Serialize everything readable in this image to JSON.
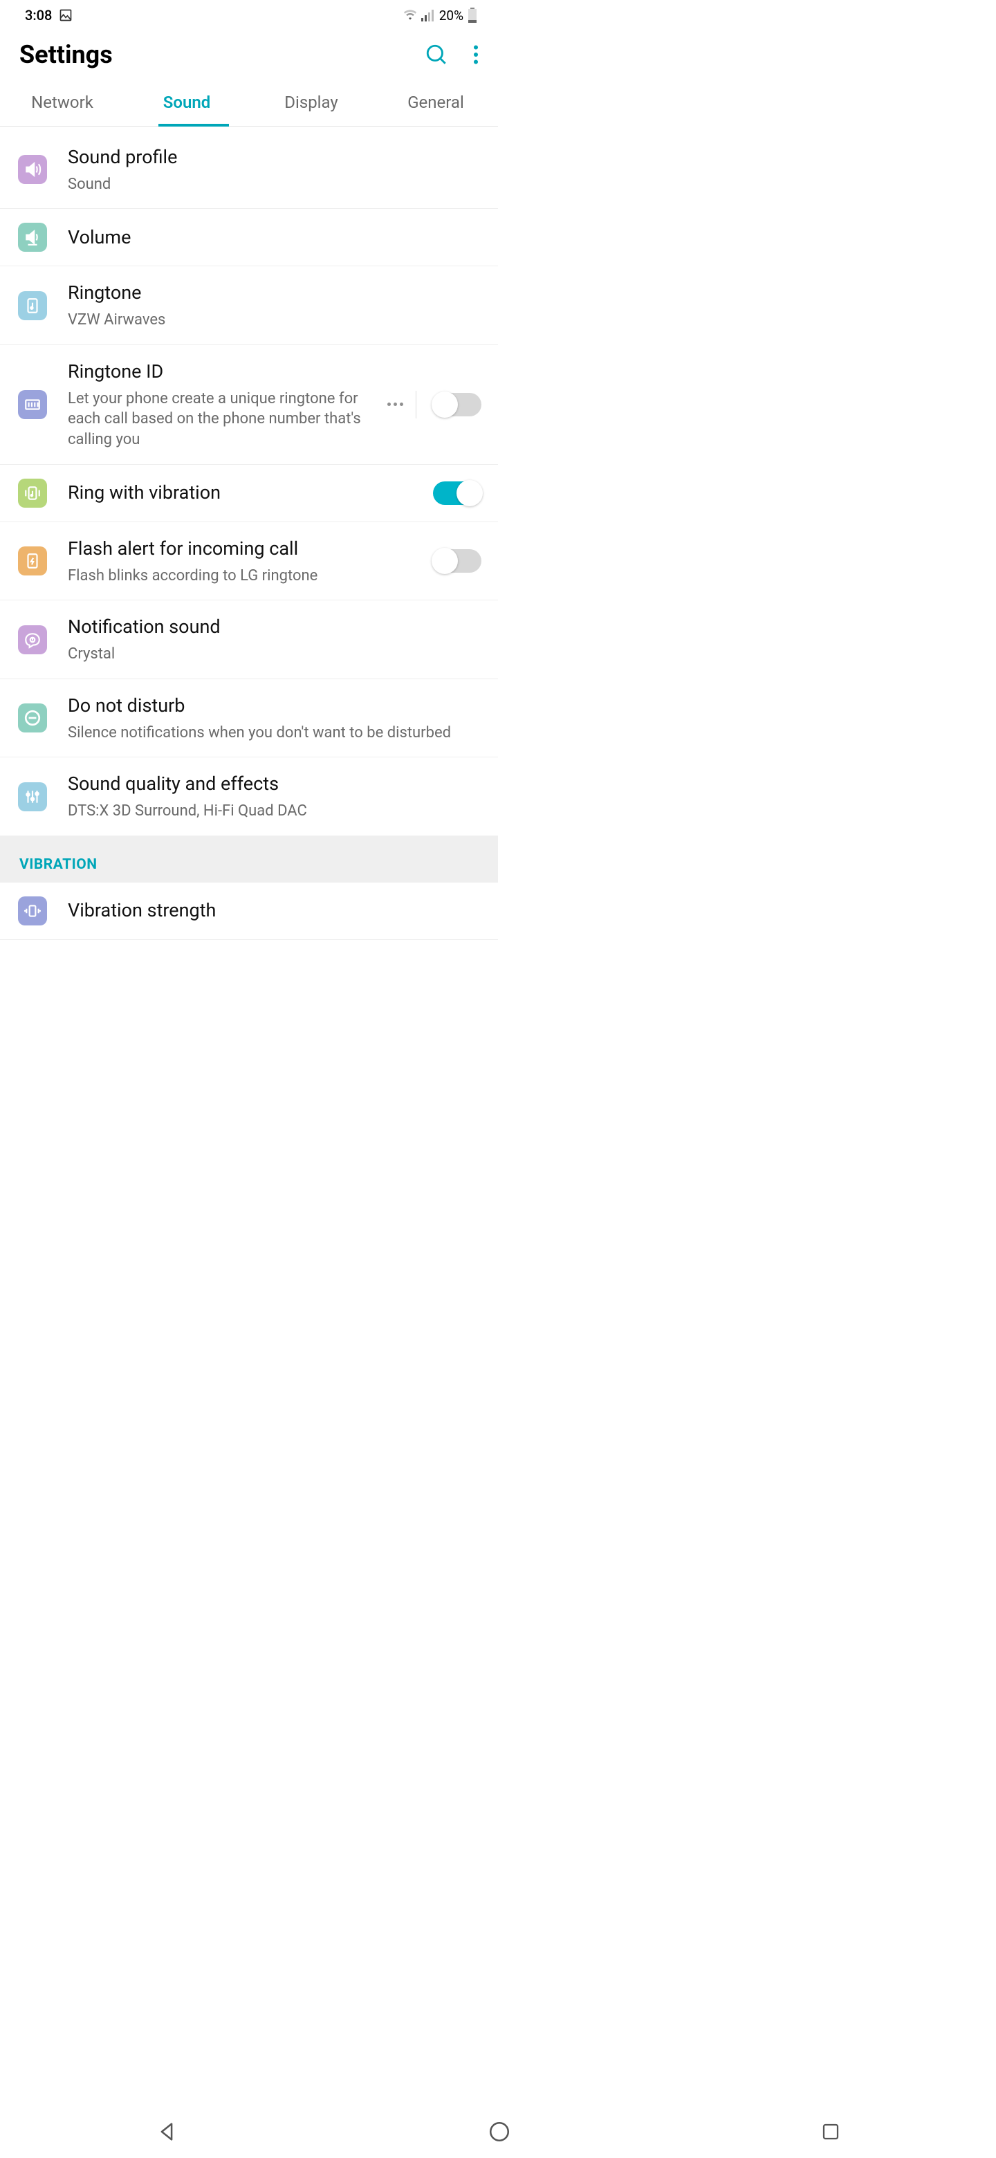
{
  "status": {
    "time": "3:08",
    "battery": "20%"
  },
  "header": {
    "title": "Settings"
  },
  "tabs": [
    {
      "label": "Network"
    },
    {
      "label": "Sound"
    },
    {
      "label": "Display"
    },
    {
      "label": "General"
    }
  ],
  "rows": {
    "sound_profile": {
      "title": "Sound profile",
      "sub": "Sound"
    },
    "volume": {
      "title": "Volume"
    },
    "ringtone": {
      "title": "Ringtone",
      "sub": "VZW Airwaves"
    },
    "ringtone_id": {
      "title": "Ringtone ID",
      "sub": "Let your phone create a unique ringtone for each call based on the phone number that's calling you"
    },
    "ring_vibration": {
      "title": "Ring with vibration"
    },
    "flash_alert": {
      "title": "Flash alert for incoming call",
      "sub": "Flash blinks according to LG ringtone"
    },
    "notification_sound": {
      "title": "Notification sound",
      "sub": "Crystal"
    },
    "dnd": {
      "title": "Do not disturb",
      "sub": "Silence notifications when you don't want to be disturbed"
    },
    "sound_quality": {
      "title": "Sound quality and effects",
      "sub": "DTS:X 3D Surround, Hi-Fi Quad DAC"
    },
    "vibration_strength": {
      "title": "Vibration strength"
    }
  },
  "section": {
    "vibration": "VIBRATION"
  },
  "toggles": {
    "ringtone_id": false,
    "ring_vibration": true,
    "flash_alert": false
  }
}
